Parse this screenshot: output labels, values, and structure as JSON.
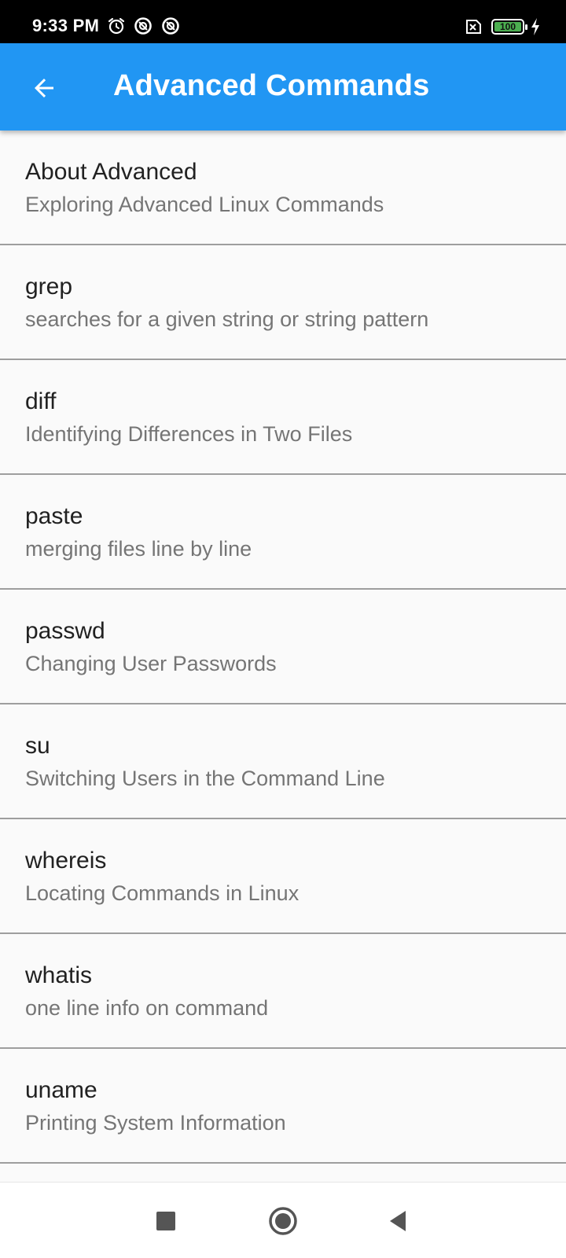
{
  "status_bar": {
    "time": "9:33 PM",
    "battery_level": "100",
    "icons": [
      "alarm-icon",
      "data-saver-icon",
      "data-saver-icon",
      "no-sim-icon",
      "battery-icon",
      "charging-icon"
    ]
  },
  "app_bar": {
    "title": "Advanced Commands",
    "back_icon": "arrow-back-icon",
    "background_color": "#2196f3"
  },
  "items": [
    {
      "title": "About Advanced",
      "subtitle": "Exploring Advanced Linux Commands"
    },
    {
      "title": "grep",
      "subtitle": "searches for a given string or string pattern"
    },
    {
      "title": "diff",
      "subtitle": "Identifying Differences in Two Files"
    },
    {
      "title": "paste",
      "subtitle": "merging files line by line"
    },
    {
      "title": "passwd",
      "subtitle": "Changing User Passwords"
    },
    {
      "title": "su",
      "subtitle": "Switching Users in the Command Line"
    },
    {
      "title": "whereis",
      "subtitle": "Locating Commands in Linux"
    },
    {
      "title": "whatis",
      "subtitle": "one line info on command"
    },
    {
      "title": "uname",
      "subtitle": "Printing System Information"
    }
  ],
  "nav_bar": {
    "buttons": [
      "recents-square-icon",
      "home-circle-icon",
      "back-triangle-icon"
    ]
  }
}
